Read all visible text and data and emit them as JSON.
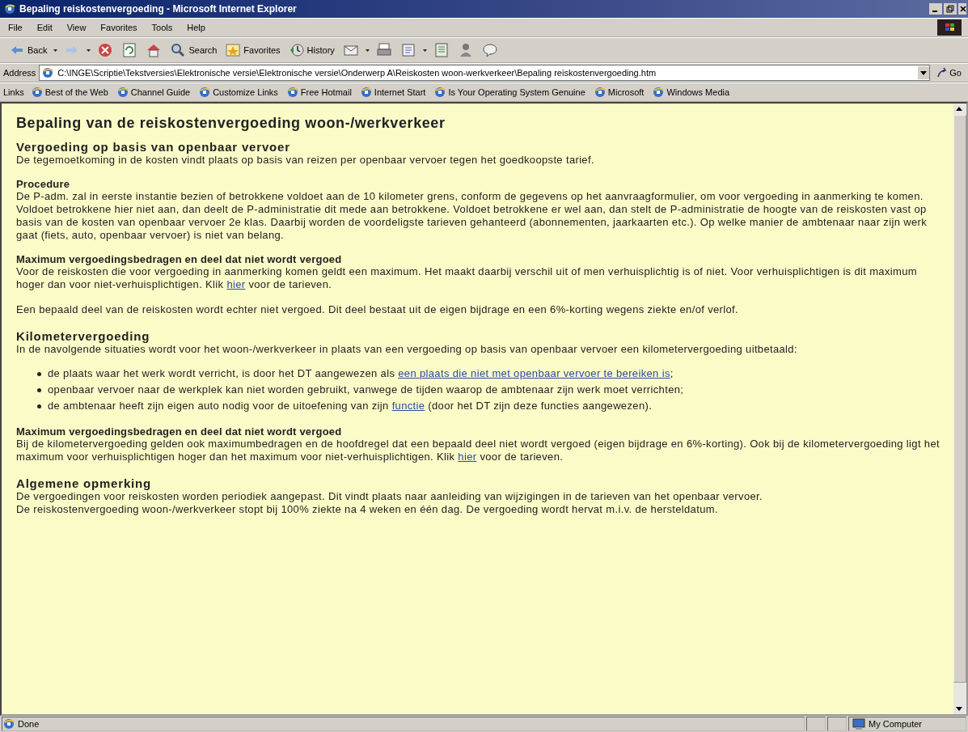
{
  "window": {
    "title": "Bepaling reiskostenvergoeding - Microsoft Internet Explorer"
  },
  "menu": [
    "File",
    "Edit",
    "View",
    "Favorites",
    "Tools",
    "Help"
  ],
  "toolbar": [
    "Back",
    "Search",
    "Favorites",
    "History"
  ],
  "address": {
    "label": "Address",
    "value": "C:\\INGE\\Scriptie\\Tekstversies\\Elektronische versie\\Elektronische versie\\Onderwerp A\\Reiskosten woon-werkverkeer\\Bepaling reiskostenvergoeding.htm",
    "go": "Go"
  },
  "links": {
    "label": "Links",
    "items": [
      "Best of the Web",
      "Channel Guide",
      "Customize Links",
      "Free Hotmail",
      "Internet Start",
      "Is Your Operating System Genuine",
      "Microsoft",
      "Windows Media"
    ]
  },
  "content": [
    {
      "kind": "h1",
      "text": "Bepaling van de reiskostenvergoeding woon-/werkverkeer"
    },
    {
      "kind": "h2",
      "text": "Vergoeding op basis van openbaar vervoer"
    },
    {
      "kind": "p",
      "parts": [
        {
          "text": "De tegemoetkoming in de kosten vindt plaats op basis van reizen per openbaar vervoer tegen het goedkoopste tarief."
        }
      ]
    },
    {
      "kind": "h3",
      "text": "Procedure"
    },
    {
      "kind": "p",
      "parts": [
        {
          "text": "De P-adm. zal in eerste instantie bezien of betrokkene voldoet aan de 10 kilometer grens, conform de gegevens op het aanvraagformulier, om voor vergoeding in aanmerking te komen."
        }
      ]
    },
    {
      "kind": "pc",
      "parts": [
        {
          "text": "Voldoet betrokkene hier niet aan, dan deelt de P-administratie dit mede aan betrokkene. Voldoet betrokkene er wel aan, dan stelt de P-administratie de hoogte van de reiskosten vast op basis van de kosten van openbaar vervoer 2e klas. Daarbij worden de voordeligste tarieven gehanteerd (abonnementen, jaarkaarten etc.). Op welke manier de ambtenaar naar zijn werk gaat (fiets, auto, openbaar vervoer) is niet van belang."
        }
      ]
    },
    {
      "kind": "h3",
      "text": "Maximum vergoedingsbedragen en deel dat niet wordt vergoed"
    },
    {
      "kind": "p",
      "parts": [
        {
          "text": "Voor de reiskosten die voor vergoeding in aanmerking komen geldt een maximum. Het maakt daarbij verschil uit of men verhuisplichtig is of niet. Voor verhuisplichtigen is dit maximum hoger dan voor niet-verhuisplichtigen. Klik "
        },
        {
          "text": "hier",
          "link": true
        },
        {
          "text": " voor de tarieven."
        }
      ]
    },
    {
      "kind": "p",
      "parts": [
        {
          "text": "Een bepaald deel van de reiskosten wordt echter niet vergoed. Dit deel bestaat uit de eigen bijdrage en een 6%-korting wegens ziekte en/of verlof."
        }
      ]
    },
    {
      "kind": "h2",
      "text": "Kilometervergoeding"
    },
    {
      "kind": "p",
      "parts": [
        {
          "text": "In de navolgende situaties wordt voor het woon-/werkverkeer in plaats van een vergoeding op basis van openbaar vervoer een kilometervergoeding uitbetaald:"
        }
      ]
    },
    {
      "kind": "ul",
      "items": [
        {
          "parts": [
            {
              "text": "de plaats waar het werk wordt verricht, is door het DT aangewezen als "
            },
            {
              "text": "een plaats die niet met openbaar vervoer te bereiken is",
              "link": true
            },
            {
              "text": ";"
            }
          ]
        },
        {
          "parts": [
            {
              "text": "openbaar vervoer naar de werkplek kan niet worden gebruikt, vanwege de tijden waarop de ambtenaar zijn werk moet verrichten;"
            }
          ]
        },
        {
          "parts": [
            {
              "text": "de ambtenaar heeft zijn eigen auto nodig voor de uitoefening van zijn "
            },
            {
              "text": "functie",
              "link": true
            },
            {
              "text": " (door het DT zijn deze functies aangewezen)."
            }
          ]
        }
      ]
    },
    {
      "kind": "h3",
      "text": "Maximum vergoedingsbedragen en deel dat niet wordt vergoed"
    },
    {
      "kind": "p",
      "parts": [
        {
          "text": "Bij de kilometervergoeding gelden ook maximumbedragen en de hoofdregel dat een bepaald deel niet wordt vergoed (eigen bijdrage en 6%-korting). Ook bij de kilometervergoeding ligt het maximum voor verhuisplichtigen hoger dan het maximum voor niet-verhuisplichtigen. Klik "
        },
        {
          "text": "hier",
          "link": true
        },
        {
          "text": " voor de tarieven."
        }
      ]
    },
    {
      "kind": "h2",
      "text": "Algemene opmerking"
    },
    {
      "kind": "p",
      "parts": [
        {
          "text": "De vergoedingen voor reiskosten worden periodiek aangepast. Dit vindt plaats naar aanleiding van wijzigingen in de tarieven van het openbaar vervoer."
        }
      ]
    },
    {
      "kind": "pc",
      "parts": [
        {
          "text": "De reiskostenvergoeding woon-/werkverkeer stopt bij 100% ziekte na 4 weken en één dag. De vergoeding wordt hervat m.i.v. de hersteldatum."
        }
      ]
    }
  ],
  "status_bar": {
    "text": "Done",
    "zone": "My Computer"
  }
}
